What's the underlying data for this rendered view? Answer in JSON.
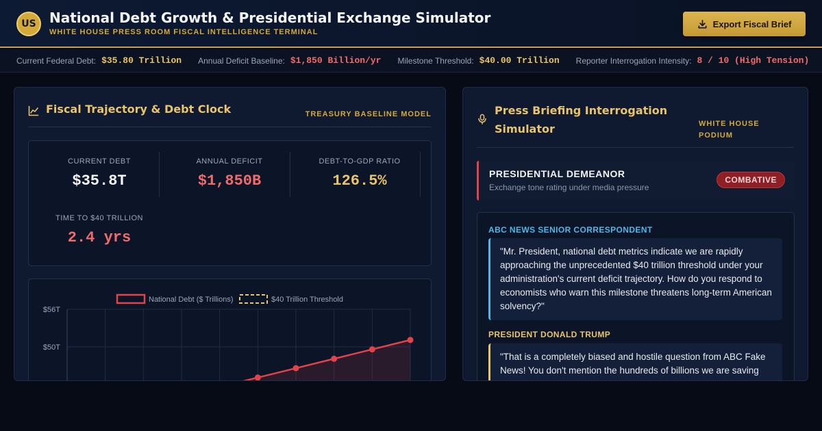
{
  "header": {
    "logo_text": "US",
    "title": "National Debt Growth & Presidential Exchange Simulator",
    "subtitle": "WHITE HOUSE PRESS ROOM FISCAL INTELLIGENCE TERMINAL",
    "export_label": "Export Fiscal Brief",
    "export_icon": "download-icon"
  },
  "ticker": {
    "items": [
      {
        "label": "Current Federal Debt:",
        "value": "$35.80 Trillion",
        "color": "#e9c46a"
      },
      {
        "label": "Annual Deficit Baseline:",
        "value": "$1,850 Billion/yr",
        "color": "#f26b6b"
      },
      {
        "label": "Milestone Threshold:",
        "value": "$40.00 Trillion",
        "color": "#e9c46a"
      },
      {
        "label": "Reporter Interrogation Intensity:",
        "value": "8 / 10 (High Tension)",
        "color": "#f26b6b"
      }
    ]
  },
  "fiscal_panel": {
    "title": "Fiscal Trajectory & Debt Clock",
    "tag": "TREASURY BASELINE MODEL",
    "icon": "line-chart-icon",
    "stats": [
      {
        "label": "CURRENT DEBT",
        "value": "$35.8T",
        "color": "#f4f6fb"
      },
      {
        "label": "ANNUAL DEFICIT",
        "value": "$1,850B",
        "color": "#f26b6b"
      },
      {
        "label": "DEBT-TO-GDP RATIO",
        "value": "126.5%",
        "color": "#e9c46a"
      },
      {
        "label": "TIME TO $40 TRILLION",
        "value": "2.4 yrs",
        "color": "#f26b6b"
      }
    ]
  },
  "chart_data": {
    "type": "line",
    "series": [
      {
        "name": "National Debt ($ Trillions)",
        "values": [
          null,
          null,
          null,
          null,
          null,
          45.1,
          46.6,
          48.1,
          49.6,
          51.1
        ],
        "color": "#e0434a"
      }
    ],
    "reference": {
      "name": "$40 Trillion Threshold",
      "value": 40,
      "color": "#e9c46a"
    },
    "y_ticks": [
      "$56T",
      "$50T"
    ],
    "ylim": [
      40,
      56
    ],
    "legend_position": "top-center",
    "grid": true
  },
  "press_panel": {
    "title": "Press Briefing Interrogation Simulator",
    "tag": "WHITE HOUSE PODIUM",
    "icon": "microphone-icon",
    "demeanor": {
      "title": "PRESIDENTIAL DEMEANOR",
      "subtitle": "Exchange tone rating under media pressure",
      "badge": "COMBATIVE"
    },
    "transcript": [
      {
        "speaker": "ABC NEWS SENIOR CORRESPONDENT",
        "text": "\"Mr. President, national debt metrics indicate we are rapidly approaching the unprecedented $40 trillion threshold under your administration's current deficit trajectory. How do you respond to economists who warn this milestone threatens long-term American solvency?\""
      },
      {
        "speaker": "PRESIDENT DONALD TRUMP",
        "text": "\"That is a completely biased and hostile question from ABC Fake News! You don't mention the hundreds of billions we are saving"
      }
    ]
  }
}
